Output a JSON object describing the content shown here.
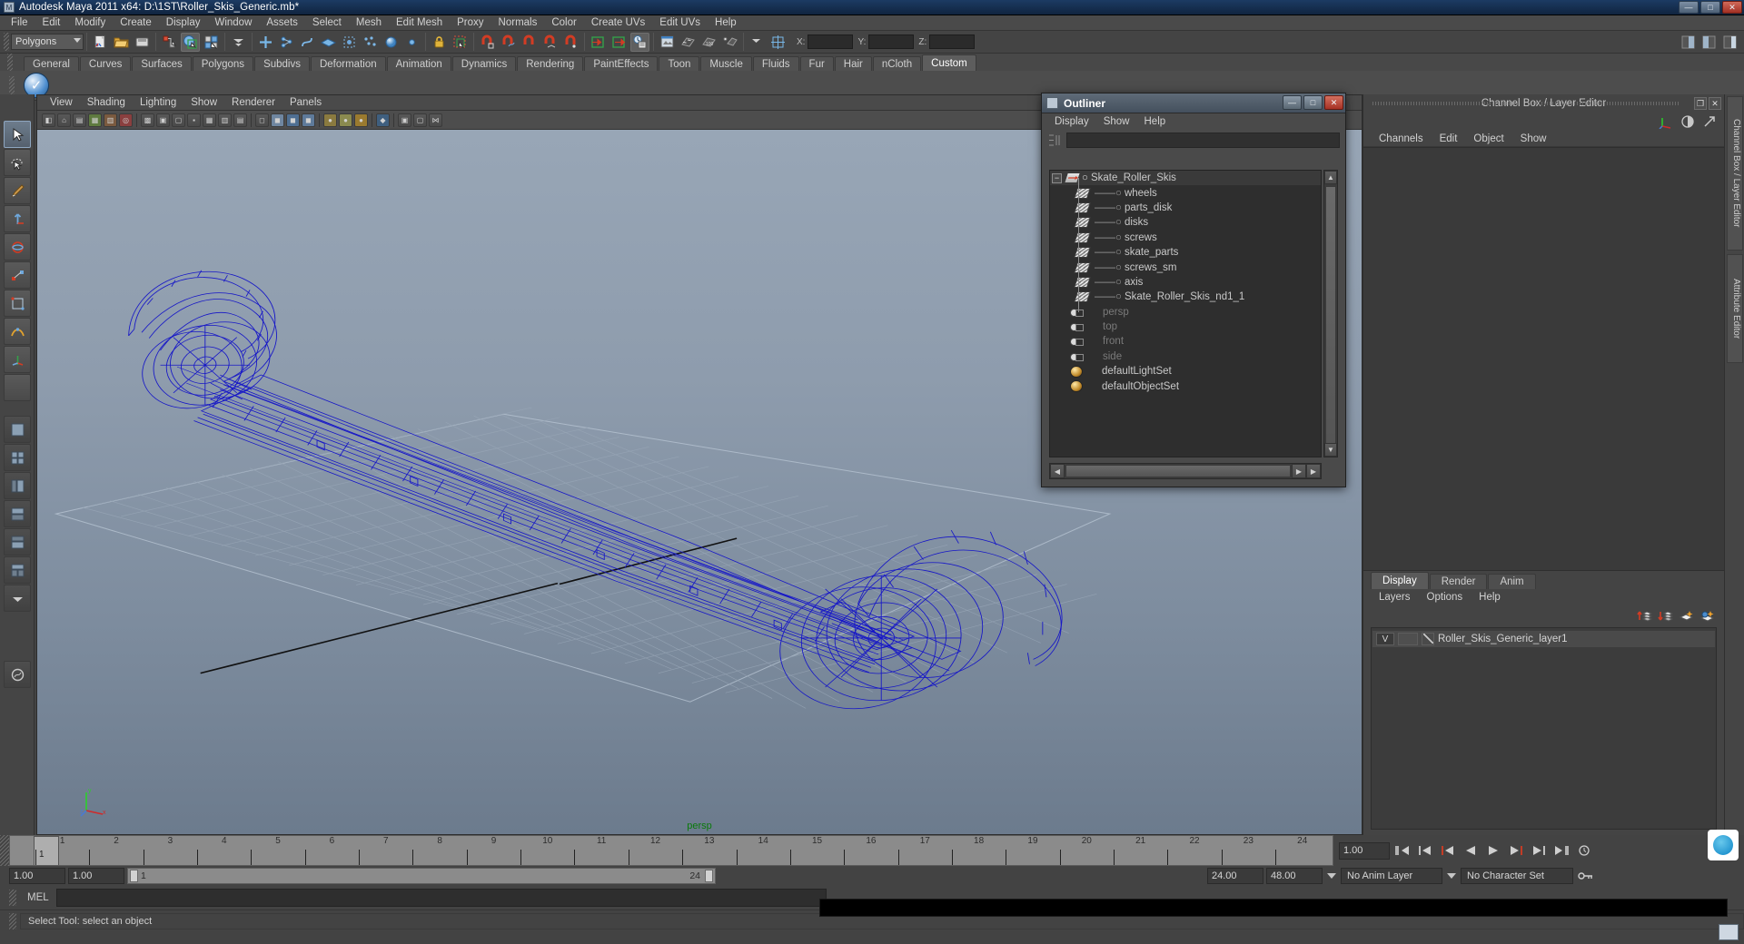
{
  "window": {
    "title": "Autodesk Maya 2011 x64: D:\\1ST\\Roller_Skis_Generic.mb*",
    "icon": "maya-icon",
    "minimize": "—",
    "maximize": "□",
    "close": "✕"
  },
  "menubar": {
    "items": [
      "File",
      "Edit",
      "Modify",
      "Create",
      "Display",
      "Window",
      "Assets",
      "Select",
      "Mesh",
      "Edit Mesh",
      "Proxy",
      "Normals",
      "Color",
      "Create UVs",
      "Edit UVs",
      "Help"
    ]
  },
  "statusline": {
    "menuset": "Polygons",
    "coord_labels": {
      "x": "X:",
      "y": "Y:",
      "z": "Z:"
    },
    "coord_values": {
      "x": "",
      "y": "",
      "z": ""
    }
  },
  "shelf": {
    "tabs": [
      "General",
      "Curves",
      "Surfaces",
      "Polygons",
      "Subdivs",
      "Deformation",
      "Animation",
      "Dynamics",
      "Rendering",
      "PaintEffects",
      "Toon",
      "Muscle",
      "Fluids",
      "Fur",
      "Hair",
      "nCloth",
      "Custom"
    ],
    "active_tab": "Custom",
    "item_icon": "blue-check-icon"
  },
  "viewport_panel": {
    "menus": [
      "View",
      "Shading",
      "Lighting",
      "Show",
      "Renderer",
      "Panels"
    ],
    "camera_label": "persp",
    "axis_labels": {
      "x": "x",
      "y": "y",
      "z": "z"
    }
  },
  "outliner": {
    "title": "Outliner",
    "icon": "maya-icon",
    "window_buttons": {
      "minimize": "—",
      "maximize": "□",
      "close": "✕"
    },
    "menus": [
      "Display",
      "Show",
      "Help"
    ],
    "search_value": "",
    "filter_icon": "filter-icon",
    "tree": [
      {
        "label": "Skate_Roller_Skis",
        "icon": "transform-icon",
        "depth": 0,
        "expander": "−",
        "selected": true,
        "dimmed": false
      },
      {
        "label": "wheels",
        "icon": "mesh-icon",
        "depth": 1,
        "selected": false,
        "dimmed": false
      },
      {
        "label": "parts_disk",
        "icon": "mesh-icon",
        "depth": 1,
        "selected": false,
        "dimmed": false
      },
      {
        "label": "disks",
        "icon": "mesh-icon",
        "depth": 1,
        "selected": false,
        "dimmed": false
      },
      {
        "label": "screws",
        "icon": "mesh-icon",
        "depth": 1,
        "selected": false,
        "dimmed": false
      },
      {
        "label": "skate_parts",
        "icon": "mesh-icon",
        "depth": 1,
        "selected": false,
        "dimmed": false
      },
      {
        "label": "screws_sm",
        "icon": "mesh-icon",
        "depth": 1,
        "selected": false,
        "dimmed": false
      },
      {
        "label": "axis",
        "icon": "mesh-icon",
        "depth": 1,
        "selected": false,
        "dimmed": false
      },
      {
        "label": "Skate_Roller_Skis_nd1_1",
        "icon": "mesh-icon",
        "depth": 1,
        "selected": false,
        "dimmed": false
      },
      {
        "label": "persp",
        "icon": "camera-icon",
        "depth": 0,
        "selected": false,
        "dimmed": true
      },
      {
        "label": "top",
        "icon": "camera-icon",
        "depth": 0,
        "selected": false,
        "dimmed": true
      },
      {
        "label": "front",
        "icon": "camera-icon",
        "depth": 0,
        "selected": false,
        "dimmed": true
      },
      {
        "label": "side",
        "icon": "camera-icon",
        "depth": 0,
        "selected": false,
        "dimmed": true
      },
      {
        "label": "defaultLightSet",
        "icon": "set-icon",
        "depth": 0,
        "selected": false,
        "dimmed": false
      },
      {
        "label": "defaultObjectSet",
        "icon": "set-icon",
        "depth": 0,
        "selected": false,
        "dimmed": false
      }
    ]
  },
  "channelbox": {
    "title": "Channel Box / Layer Editor",
    "window_buttons": {
      "restore": "❐",
      "close": "✕"
    },
    "menus": [
      "Channels",
      "Edit",
      "Object",
      "Show"
    ],
    "header_icons": [
      "axis-gizmo-icon",
      "half-circle-icon",
      "arrow-icon"
    ]
  },
  "layer_editor": {
    "tabs": [
      "Display",
      "Render",
      "Anim"
    ],
    "active_tab": "Display",
    "menus": [
      "Layers",
      "Options",
      "Help"
    ],
    "toolbar_icons": [
      "layer-up-icon",
      "layer-down-icon",
      "new-layer-icon",
      "new-layer-from-selected-icon"
    ],
    "layers": [
      {
        "visibility": "V",
        "playback": "",
        "type": "",
        "name": "Roller_Skis_Generic_layer1"
      }
    ]
  },
  "right_vtabs": [
    "Channel Box / Layer Editor",
    "Attribute Editor"
  ],
  "timeline": {
    "frame_numbers": [
      "1",
      "2",
      "3",
      "4",
      "5",
      "6",
      "7",
      "8",
      "9",
      "10",
      "11",
      "12",
      "13",
      "14",
      "15",
      "16",
      "17",
      "18",
      "19",
      "20",
      "21",
      "22",
      "23",
      "24"
    ],
    "current_frame": "1",
    "current_time_field": "1.00",
    "playback_buttons": [
      "go-to-start-icon",
      "step-back-key-icon",
      "step-back-frame-icon",
      "play-backwards-icon",
      "play-forwards-icon",
      "step-forward-frame-icon",
      "step-forward-key-icon",
      "go-to-end-icon"
    ]
  },
  "range_slider": {
    "anim_start": "1.00",
    "range_start": "1.00",
    "bar_start_label": "1",
    "bar_end_label": "24",
    "range_end": "24.00",
    "anim_end": "48.00",
    "anim_layer": "No Anim Layer",
    "character_set": "No Character Set",
    "key_icon": "key-icon"
  },
  "command_line": {
    "label": "MEL",
    "input_value": "",
    "output_value": ""
  },
  "help_line": {
    "text": "Select Tool: select an object"
  },
  "tray": {
    "teamviewer_icon": "teamviewer-icon",
    "app_icon": "app-icon"
  },
  "colors": {
    "title_bar": "#10243f",
    "chrome": "#444444",
    "viewport_top": "#98a6b6",
    "viewport_bottom": "#6c7b8d",
    "wireframe": "#1414c8",
    "grid": "#8f9dae",
    "camera_label": "#0a7a0a",
    "accent_selected": "#3a3a3a"
  }
}
